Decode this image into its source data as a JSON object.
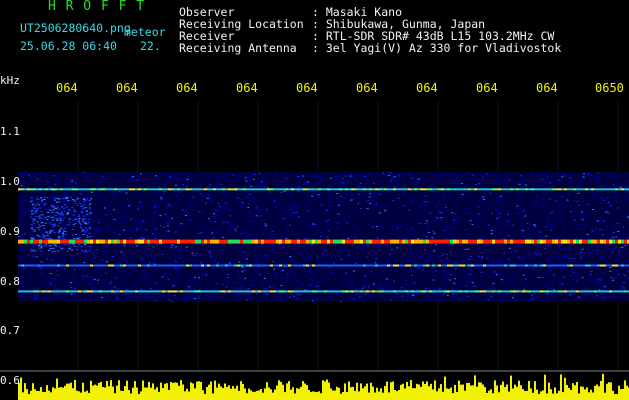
{
  "header": {
    "app_name": "H R O F F T",
    "filename": "UT2506280640.png",
    "type_label": "meteor",
    "date_time": "25.06.28 06:40",
    "extra_value": "22.",
    "info_keys": [
      "Observer",
      "Receiving Location",
      "Receiver",
      "Receiving Antenna"
    ],
    "info_values": [
      ": Masaki Kano",
      ": Shibukawa, Gunma, Japan",
      ": RTL-SDR SDR# 43dB L15 103.2MHz CW",
      ": 3el Yagi(V) Az 330 for Vladivostok"
    ]
  },
  "time_axis": {
    "labels": [
      "064",
      "064",
      "064",
      "064",
      "064",
      "064",
      "064",
      "064",
      "064",
      "0650"
    ]
  },
  "freq_axis": {
    "unit": "kHz",
    "labels": [
      "1.1",
      "1.0",
      "0.9",
      "0.8",
      "0.7",
      "0.6"
    ]
  },
  "spectrogram": {
    "bands_khz": [
      0.985,
      0.88,
      0.832,
      0.78
    ],
    "noise_range_khz": [
      0.76,
      1.02
    ],
    "background_color": "#000000",
    "noise_color": "#0000c8",
    "strong_color": "#ff2000"
  },
  "level_strip": {
    "color": "#f2f200",
    "description": "signal level"
  }
}
